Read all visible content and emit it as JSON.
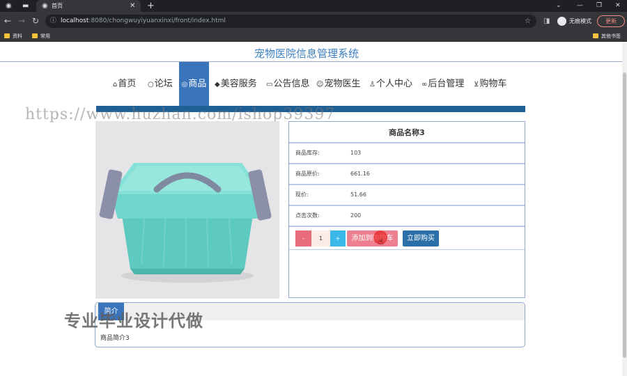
{
  "browser": {
    "tab_title": "首页",
    "url_host": "localhost",
    "url_rest": ":8080/chongwuyiyuanxinxi/front/index.html",
    "incognito_label": "无痕模式",
    "update_label": "更新",
    "bookmarks": [
      "资料",
      "常用"
    ],
    "other_bookmarks": "其他书签"
  },
  "site": {
    "title": "宠物医院信息管理系统"
  },
  "nav": [
    {
      "icon": "⌂",
      "label": "首页"
    },
    {
      "icon": "○",
      "label": "论坛"
    },
    {
      "icon": "◎",
      "label": "商品"
    },
    {
      "icon": "◆",
      "label": "美容服务"
    },
    {
      "icon": "▭",
      "label": "公告信息"
    },
    {
      "icon": "☺",
      "label": "宠物医生"
    },
    {
      "icon": "♙",
      "label": "个人中心"
    },
    {
      "icon": "∞",
      "label": "后台管理"
    },
    {
      "icon": "⊻",
      "label": "购物车"
    }
  ],
  "watermark_url": "https://www.huzhan.com/ishop39397",
  "product": {
    "name": "商品名称3",
    "rows": [
      {
        "label": "商品库存:",
        "value": "103"
      },
      {
        "label": "商品原价:",
        "value": "661.16"
      },
      {
        "label": "现价:",
        "value": "51.66"
      },
      {
        "label": "点击次数:",
        "value": "200"
      }
    ],
    "quantity": "1",
    "minus": "-",
    "plus": "+",
    "add_cart_label": "添加到购物车",
    "buy_now_label": "立即购买"
  },
  "intro": {
    "tab_label": "简介",
    "text": "商品简介3"
  },
  "watermark_text": "专业毕业设计代做",
  "colors": {
    "nav_active": "#3a74bb",
    "blue_bar": "#1e5f96",
    "add_cart": "#ee7f90",
    "buy_now": "#2a6fa8",
    "minus": "#e86c7c",
    "plus": "#3ab9e9"
  }
}
